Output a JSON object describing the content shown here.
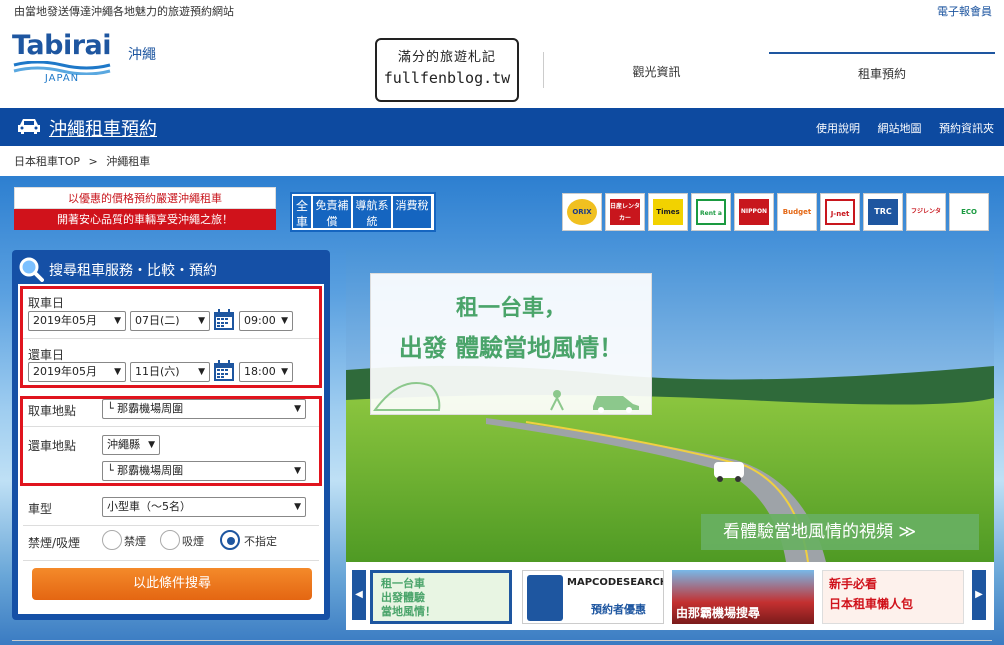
{
  "topbar": {
    "tagline": "由當地發送傳達沖繩各地魅力的旅遊預約網站",
    "member_link": "電子報會員"
  },
  "header": {
    "logo_text": "Tabirai",
    "logo_sub": "JAPAN",
    "region": "沖繩",
    "stamp_line1": "滿分的旅遊札記",
    "stamp_line2": "fullfenblog.tw",
    "nav": [
      "觀光資訊",
      "租車預約"
    ]
  },
  "bluebar": {
    "title": "沖繩租車預約",
    "links": [
      "使用說明",
      "網站地圖",
      "預約資訊夾"
    ]
  },
  "breadcrumb": {
    "home": "日本租車TOP",
    "sep": ">",
    "current": "沖繩租車"
  },
  "promo": {
    "line1": "以優惠的價格預約嚴選沖繩租車",
    "line2": "開著安心品質的車輛享受沖繩之旅！"
  },
  "features": {
    "all": "全車",
    "items": [
      "免責補償",
      "導航系統",
      "消費稅"
    ]
  },
  "brands": [
    "ORIX",
    "日産レンタカー",
    "Times Car",
    "Rent a Car",
    "NIPPON",
    "Budget",
    "J-net",
    "TRC",
    "フジレンタカー",
    "ECO"
  ],
  "search": {
    "title": "搜尋租車服務・比較・預約",
    "pickup_label": "取車日",
    "pickup_month": "2019年05月",
    "pickup_day": "07日(二)",
    "pickup_time": "09:00",
    "return_label": "還車日",
    "return_month": "2019年05月",
    "return_day": "11日(六)",
    "return_time": "18:00",
    "pickup_place_label": "取車地點",
    "pickup_place": "└ 那霸機場周圍",
    "return_place_label": "還車地點",
    "return_pref": "沖繩縣",
    "return_place": "└ 那霸機場周圍",
    "car_type_label": "車型",
    "car_type": "小型車（～5名）",
    "smoking_label": "禁煙/吸煙",
    "smoking_options": [
      "禁煙",
      "吸煙",
      "不指定"
    ],
    "submit": "以此條件搜尋"
  },
  "hero": {
    "tag_line1": "租一台車，",
    "tag_line2": "出發 體驗當地風情！",
    "video_button": "看體驗當地風情的視頻 ≫"
  },
  "thumbs": [
    {
      "text": "租一台車\n出發體驗\n當地風情！"
    },
    {
      "title": "MAPCODESEARCH",
      "caption": "預約者優惠"
    },
    {
      "caption": "由那霸機場搜尋"
    },
    {
      "title": "新手必看",
      "caption": "日本租車懶人包"
    }
  ],
  "colors": {
    "brand_blue": "#0d4aa0",
    "accent_red": "#e0141e",
    "search_orange": "#e46612",
    "promo_green": "#4aa46a"
  }
}
